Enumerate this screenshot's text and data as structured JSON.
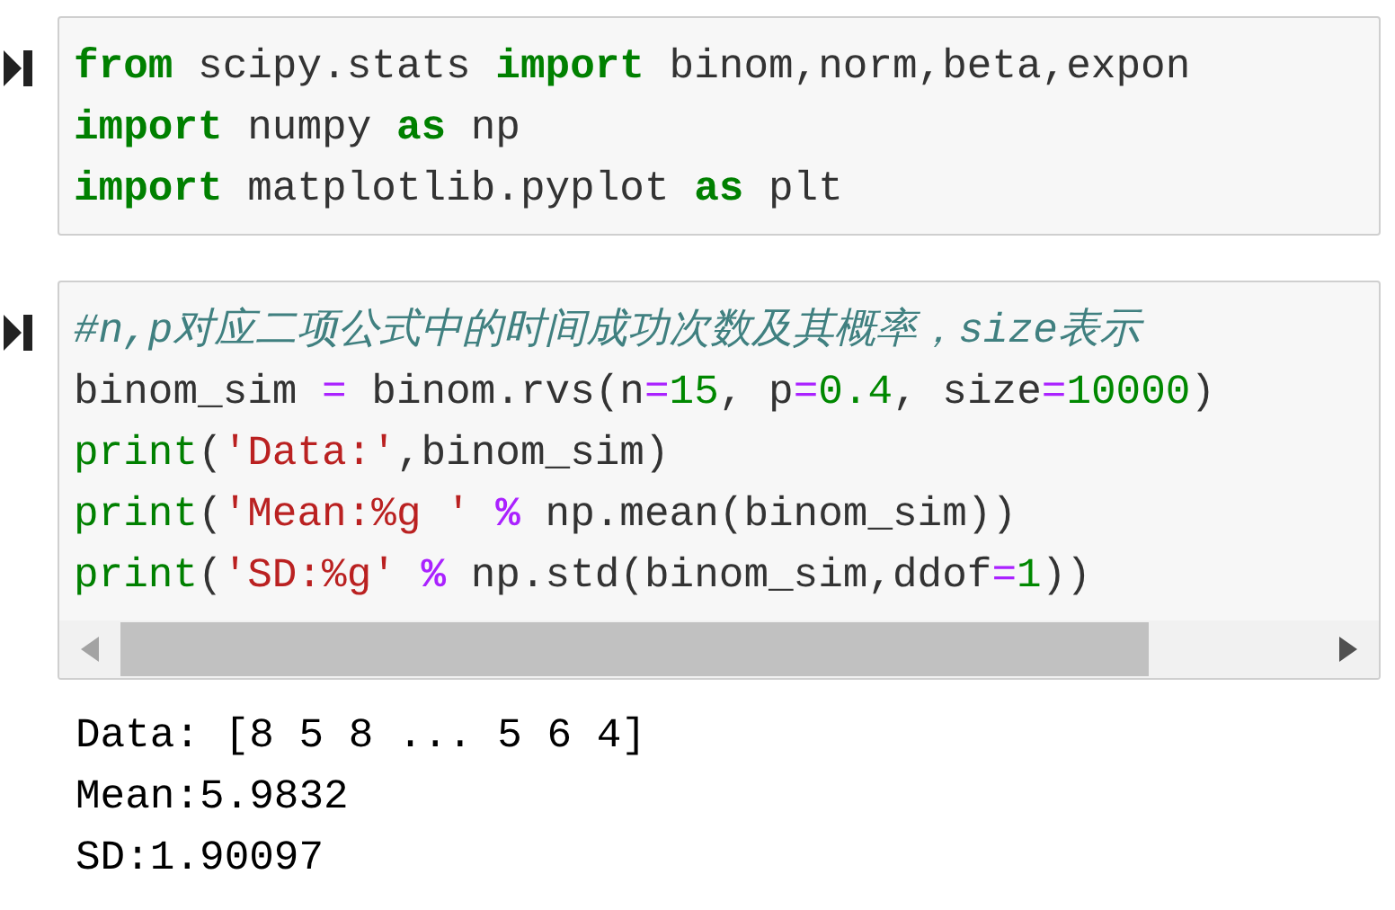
{
  "cells": [
    {
      "lines": [
        [
          {
            "kind": "keyword",
            "text": "from"
          },
          {
            "kind": "plain",
            "text": " scipy.stats "
          },
          {
            "kind": "keyword",
            "text": "import"
          },
          {
            "kind": "plain",
            "text": " binom,norm,beta,expon"
          }
        ],
        [
          {
            "kind": "keyword",
            "text": "import"
          },
          {
            "kind": "plain",
            "text": " numpy "
          },
          {
            "kind": "keyword",
            "text": "as"
          },
          {
            "kind": "plain",
            "text": " np"
          }
        ],
        [
          {
            "kind": "keyword",
            "text": "import"
          },
          {
            "kind": "plain",
            "text": " matplotlib.pyplot "
          },
          {
            "kind": "keyword",
            "text": "as"
          },
          {
            "kind": "plain",
            "text": " plt"
          }
        ]
      ]
    },
    {
      "scrollbar": true,
      "lines": [
        [
          {
            "kind": "comment",
            "text": "#n,p对应二项公式中的时间成功次数及其概率，size表示"
          }
        ],
        [
          {
            "kind": "plain",
            "text": "binom_sim "
          },
          {
            "kind": "operator",
            "text": "="
          },
          {
            "kind": "plain",
            "text": " binom.rvs(n"
          },
          {
            "kind": "operator",
            "text": "="
          },
          {
            "kind": "number",
            "text": "15"
          },
          {
            "kind": "plain",
            "text": ", p"
          },
          {
            "kind": "operator",
            "text": "="
          },
          {
            "kind": "number",
            "text": "0.4"
          },
          {
            "kind": "plain",
            "text": ", size"
          },
          {
            "kind": "operator",
            "text": "="
          },
          {
            "kind": "number",
            "text": "10000"
          },
          {
            "kind": "plain",
            "text": ")"
          }
        ],
        [
          {
            "kind": "builtin",
            "text": "print"
          },
          {
            "kind": "plain",
            "text": "("
          },
          {
            "kind": "string",
            "text": "'Data:'"
          },
          {
            "kind": "plain",
            "text": ",binom_sim)"
          }
        ],
        [
          {
            "kind": "builtin",
            "text": "print"
          },
          {
            "kind": "plain",
            "text": "("
          },
          {
            "kind": "string",
            "text": "'Mean:%g ' "
          },
          {
            "kind": "percent",
            "text": "%"
          },
          {
            "kind": "plain",
            "text": " np.mean(binom_sim))"
          }
        ],
        [
          {
            "kind": "builtin",
            "text": "print"
          },
          {
            "kind": "plain",
            "text": "("
          },
          {
            "kind": "string",
            "text": "'SD:%g' "
          },
          {
            "kind": "percent",
            "text": "%"
          },
          {
            "kind": "plain",
            "text": " np.std(binom_sim,ddof"
          },
          {
            "kind": "operator",
            "text": "="
          },
          {
            "kind": "number",
            "text": "1"
          },
          {
            "kind": "plain",
            "text": "))"
          }
        ]
      ],
      "output": [
        "Data: [8 5 8 ... 5 6 4]",
        "Mean:5.9832",
        "SD:1.90097"
      ]
    }
  ]
}
